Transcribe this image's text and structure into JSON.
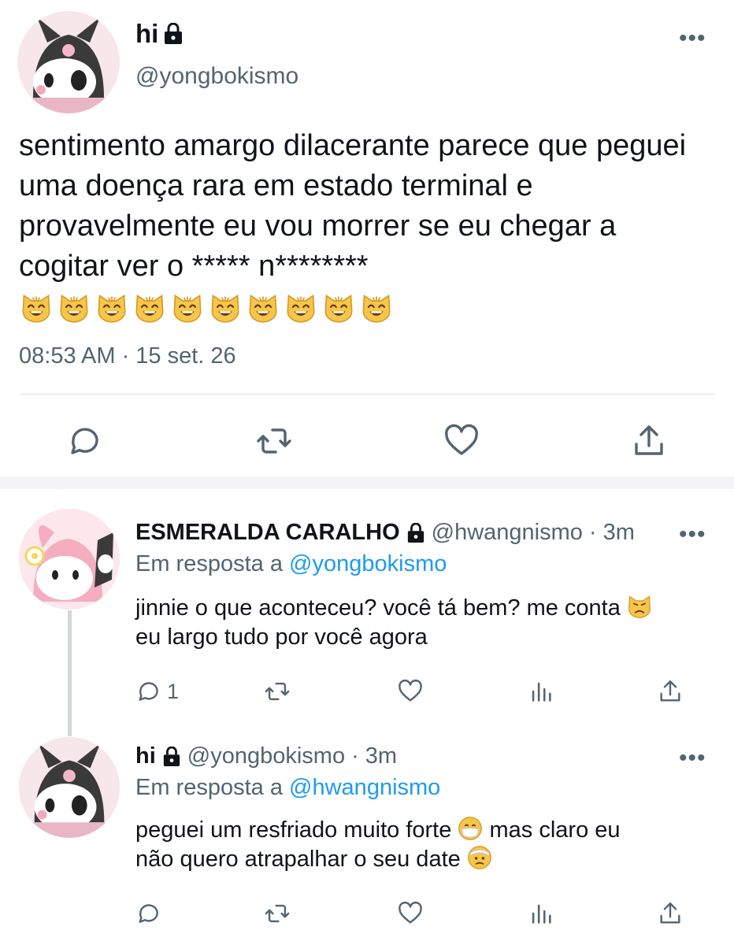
{
  "main_tweet": {
    "display_name": "hi",
    "handle": "@yongbokismo",
    "text": "sentimento amargo dilacerante parece que peguei uma doença rara em estado terminal e provavelmente eu vou morrer se eu chegar a cogitar ver o ***** n********",
    "emoji_name": "grinning-cat-emoji",
    "emoji_count": 10,
    "timestamp": "08:53 AM · 15 set. 26",
    "more_icon": "more-horizontal-icon",
    "actions": [
      "reply-icon",
      "retweet-icon",
      "like-icon",
      "share-icon"
    ]
  },
  "replies": [
    {
      "display_name": "ESMERALDA CARALHO",
      "handle": "@hwangnismo",
      "time": "· 3m",
      "reply_prefix": "Em resposta a",
      "reply_to": "@yongbokismo",
      "text_line1": "jinnie o que aconteceu? você tá bem? me conta",
      "text_line2": "eu largo tudo por você agora",
      "reply_count": "1",
      "emoji_name": "pouting-cat-emoji"
    },
    {
      "display_name": "hi",
      "handle": "@yongbokismo",
      "time": "· 3m",
      "reply_prefix": "Em resposta a",
      "reply_to": "@hwangnismo",
      "text_line1_a": "peguei um resfriado muito forte",
      "text_line1_b": "mas claro eu",
      "text_line2": "não quero atrapalhar o seu date",
      "emoji_names": [
        "face-with-medical-mask-emoji",
        "face-with-head-bandage-emoji"
      ]
    }
  ],
  "colors": {
    "text": "#0f1419",
    "muted": "#536471",
    "link": "#1d9bf0",
    "divider": "#dfe4e8"
  }
}
